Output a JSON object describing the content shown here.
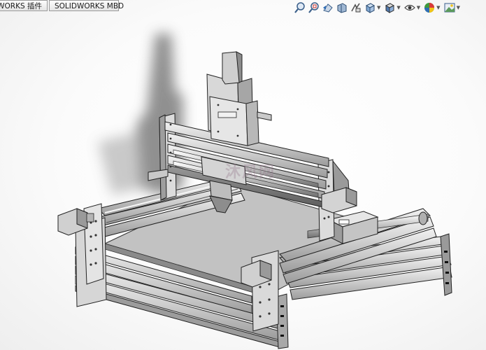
{
  "tabs": {
    "first_label": "SOLIDWORKS 插件",
    "second_label": "SOLIDWORKS MBD"
  },
  "view_toolbar": {
    "icons": [
      "zoom-to-fit-icon",
      "zoom-to-area-icon",
      "previous-view-icon",
      "section-view-icon",
      "dynamic-annotation-icon",
      "view-orientation-icon",
      "display-style-icon",
      "hide-show-items-icon",
      "edit-appearance-icon",
      "apply-scene-icon"
    ]
  },
  "watermark": {
    "text": "沐风网"
  },
  "colors": {
    "aluminum_light": "#e6e6e6",
    "aluminum_mid": "#bdbdbd",
    "aluminum_dark": "#7a7a7a",
    "edge": "#222222"
  }
}
